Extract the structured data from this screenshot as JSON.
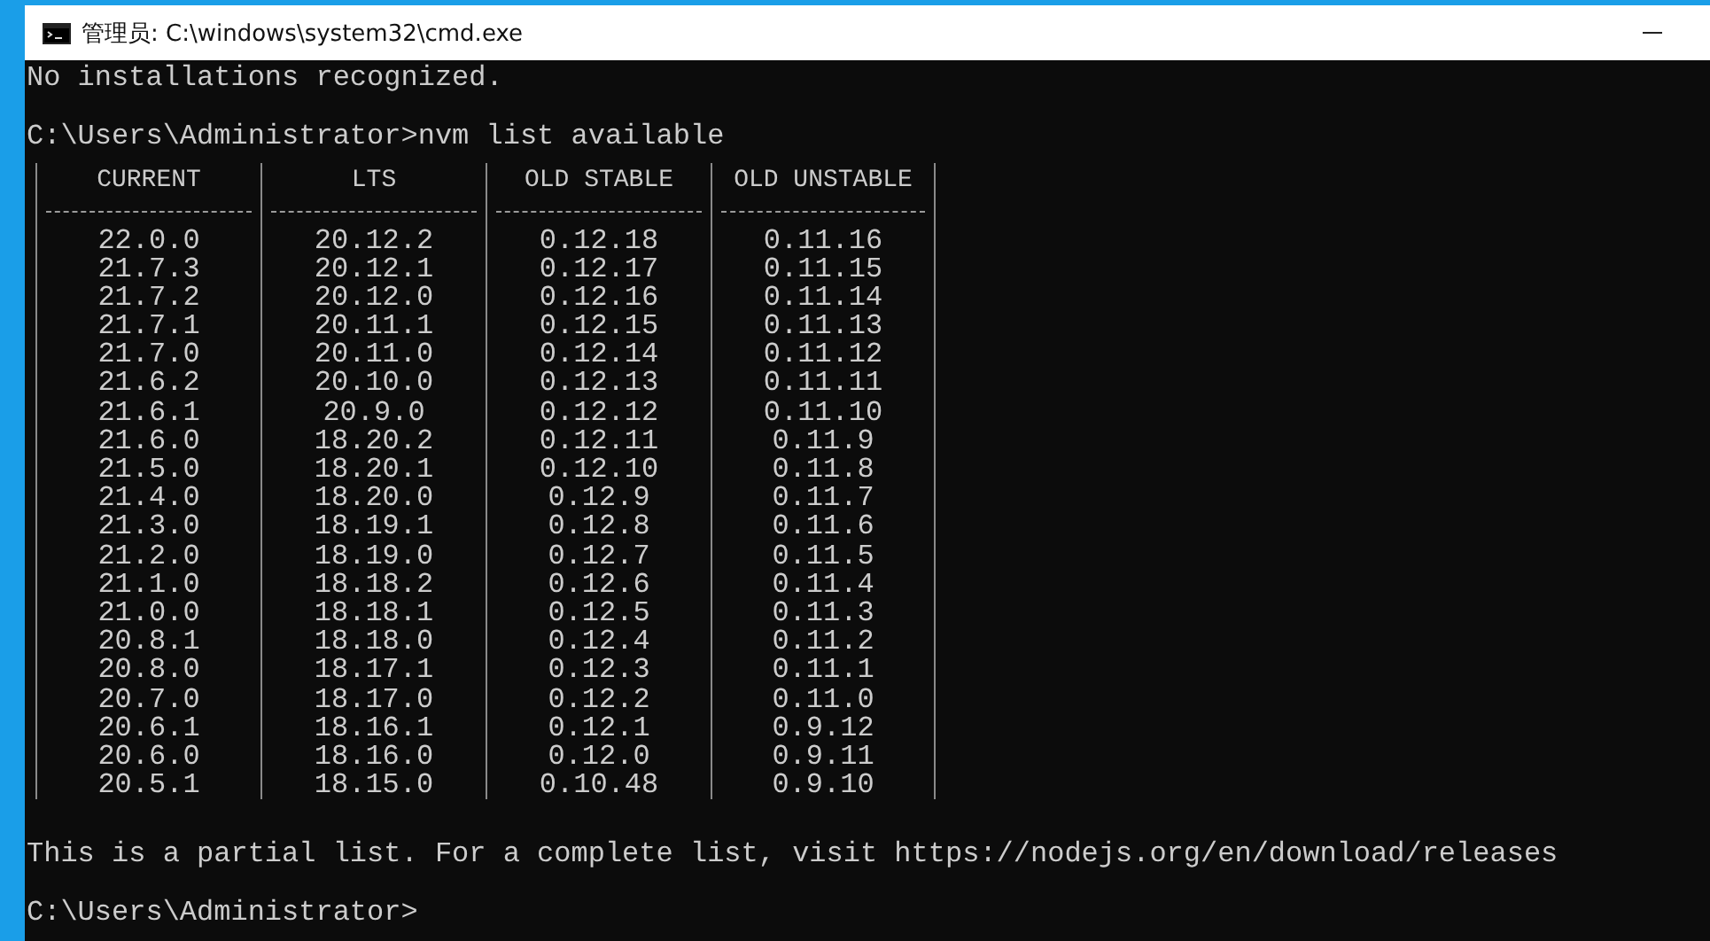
{
  "window": {
    "title": "管理员: C:\\windows\\system32\\cmd.exe"
  },
  "output_lines": [
    "No installations recognized.",
    "C:\\Users\\Administrator>nvm list available"
  ],
  "table": {
    "columns": [
      "CURRENT",
      "LTS",
      "OLD STABLE",
      "OLD UNSTABLE"
    ],
    "rows": [
      [
        "22.0.0",
        "20.12.2",
        "0.12.18",
        "0.11.16"
      ],
      [
        "21.7.3",
        "20.12.1",
        "0.12.17",
        "0.11.15"
      ],
      [
        "21.7.2",
        "20.12.0",
        "0.12.16",
        "0.11.14"
      ],
      [
        "21.7.1",
        "20.11.1",
        "0.12.15",
        "0.11.13"
      ],
      [
        "21.7.0",
        "20.11.0",
        "0.12.14",
        "0.11.12"
      ],
      [
        "21.6.2",
        "20.10.0",
        "0.12.13",
        "0.11.11"
      ],
      [
        "21.6.1",
        "20.9.0",
        "0.12.12",
        "0.11.10"
      ],
      [
        "21.6.0",
        "18.20.2",
        "0.12.11",
        "0.11.9"
      ],
      [
        "21.5.0",
        "18.20.1",
        "0.12.10",
        "0.11.8"
      ],
      [
        "21.4.0",
        "18.20.0",
        "0.12.9",
        "0.11.7"
      ],
      [
        "21.3.0",
        "18.19.1",
        "0.12.8",
        "0.11.6"
      ],
      [
        "21.2.0",
        "18.19.0",
        "0.12.7",
        "0.11.5"
      ],
      [
        "21.1.0",
        "18.18.2",
        "0.12.6",
        "0.11.4"
      ],
      [
        "21.0.0",
        "18.18.1",
        "0.12.5",
        "0.11.3"
      ],
      [
        "20.8.1",
        "18.18.0",
        "0.12.4",
        "0.11.2"
      ],
      [
        "20.8.0",
        "18.17.1",
        "0.12.3",
        "0.11.1"
      ],
      [
        "20.7.0",
        "18.17.0",
        "0.12.2",
        "0.11.0"
      ],
      [
        "20.6.1",
        "18.16.1",
        "0.12.1",
        "0.9.12"
      ],
      [
        "20.6.0",
        "18.16.0",
        "0.12.0",
        "0.9.11"
      ],
      [
        "20.5.1",
        "18.15.0",
        "0.10.48",
        "0.9.10"
      ]
    ]
  },
  "footer_lines": [
    "This is a partial list. For a complete list, visit https://nodejs.org/en/download/releases",
    "C:\\Users\\Administrator>"
  ]
}
